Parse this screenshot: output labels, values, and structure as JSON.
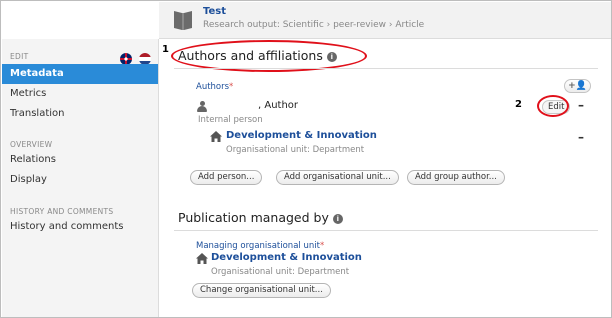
{
  "header": {
    "title": "Test",
    "subtitle": "Research output: Scientific › peer-review › Article",
    "icon": "book-icon"
  },
  "sidebar": {
    "edit_section": "EDIT",
    "items_edit": [
      {
        "label": "Metadata",
        "active": true
      },
      {
        "label": "Metrics",
        "active": false
      },
      {
        "label": "Translation",
        "active": false
      }
    ],
    "overview_section": "OVERVIEW",
    "items_overview": [
      {
        "label": "Relations"
      },
      {
        "label": "Display"
      }
    ],
    "history_section": "HISTORY AND COMMENTS",
    "items_history": [
      {
        "label": "History and comments"
      }
    ],
    "flags": [
      "uk-flag-icon",
      "nl-flag-icon"
    ]
  },
  "annotations": {
    "step1": "1",
    "step2": "2",
    "highlight_color": "#e0101a"
  },
  "authors_section": {
    "title": "Authors and affiliations",
    "authors_label": "Authors",
    "required_mark": "*",
    "add_author_icon": "+👤",
    "author": {
      "name": ", Author",
      "type": "Internal person",
      "edit_label": "Edit",
      "remove_label": "–"
    },
    "organisation": {
      "name": "Development & Innovation",
      "type": "Organisational unit: Department",
      "remove_label": "–"
    },
    "buttons": {
      "add_person": "Add person...",
      "add_org_unit": "Add organisational unit...",
      "add_group_author": "Add group author..."
    }
  },
  "publication_section": {
    "title": "Publication managed by",
    "managing_label": "Managing organisational unit",
    "required_mark": "*",
    "organisation": {
      "name": "Development & Innovation",
      "type": "Organisational unit: Department"
    },
    "change_button": "Change organisational unit..."
  },
  "colors": {
    "accent": "#2a8bd8",
    "link": "#1d4f9a",
    "required": "#d9534f"
  }
}
